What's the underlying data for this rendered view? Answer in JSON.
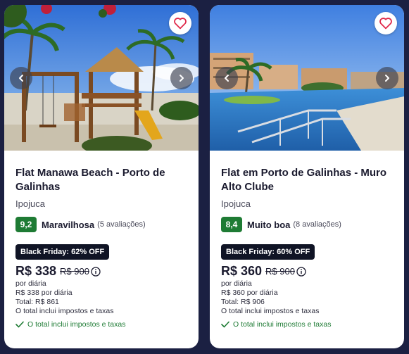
{
  "cards": [
    {
      "title": "Flat Manawa Beach - Porto de Galinhas",
      "location": "Ipojuca",
      "rating_score": "9,2",
      "rating_label": "Maravilhosa",
      "rating_count": "(5 avaliações)",
      "deal": "Black Friday: 62% OFF",
      "price": "R$ 338",
      "old_price": "R$ 900",
      "per_night": "por diária",
      "nightly": "R$ 338 por diária",
      "total": "Total: R$ 861",
      "taxes_note": "O total inclui impostos e taxas",
      "included": "O total inclui impostos e taxas"
    },
    {
      "title": "Flat em Porto de Galinhas - Muro Alto Clube",
      "location": "Ipojuca",
      "rating_score": "8,4",
      "rating_label": "Muito boa",
      "rating_count": "(8 avaliações)",
      "deal": "Black Friday: 60% OFF",
      "price": "R$ 360",
      "old_price": "R$ 900",
      "per_night": "por diária",
      "nightly": "R$ 360 por diária",
      "total": "Total: R$ 906",
      "taxes_note": "O total inclui impostos e taxas",
      "included": "O total inclui impostos e taxas"
    }
  ],
  "colors": {
    "background": "#1b2042",
    "rating_green": "#1e7b34",
    "favorite_red": "#e0294a",
    "deal_badge": "#101425"
  },
  "icons": [
    "heart-icon",
    "chevron-left-icon",
    "chevron-right-icon",
    "info-icon",
    "check-icon"
  ]
}
